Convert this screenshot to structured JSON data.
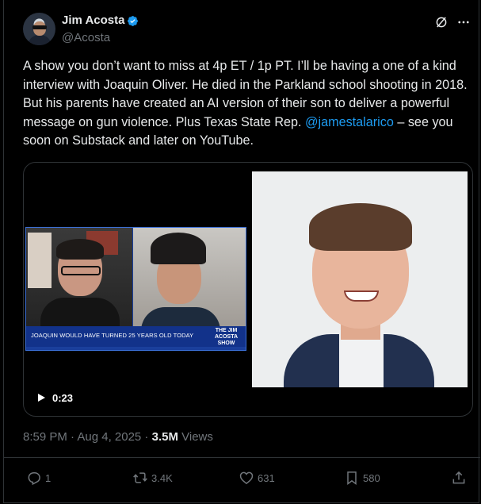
{
  "author": {
    "name": "Jim Acosta",
    "handle": "@Acosta",
    "verified": true,
    "avatar_icon": "avatar"
  },
  "tweet": {
    "text_before": "A show you don’t want to miss at 4p ET / 1p PT. I’ll be having a one of a kind interview with Joaquin Oliver. He died in the Parkland school shooting in 2018. But his parents have created an AI version of their son to deliver a powerful message on gun violence. Plus Texas State Rep. ",
    "mention": "@jamestalarico",
    "text_after": " – see you soon on Substack and later on YouTube."
  },
  "media": {
    "video_caption": "JOAQUIN WOULD HAVE TURNED 25 YEARS OLD TODAY",
    "show_logo_top": "THE JIM",
    "show_logo_main": "ACOSTA",
    "show_logo_bottom": "SHOW",
    "duration": "0:23"
  },
  "meta": {
    "timestamp": "8:59 PM · Aug 4, 2025 · ",
    "views_count": "3.5M",
    "views_label": " Views"
  },
  "actions": {
    "replies": "1",
    "reposts": "3.4K",
    "likes": "631",
    "bookmarks": "580"
  },
  "colors": {
    "background": "#000000",
    "text": "#e7e9ea",
    "secondary": "#71767b",
    "link": "#1d9bf0",
    "border": "#2f3336"
  }
}
